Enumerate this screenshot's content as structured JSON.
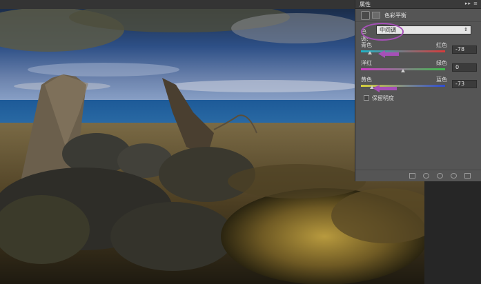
{
  "panel": {
    "tab": "属性",
    "header_title": "色彩平衡",
    "tone": {
      "label": "色调:",
      "value": "中间调"
    },
    "sliders": [
      {
        "left": "青色",
        "right": "红色",
        "value": "-78",
        "level": -78
      },
      {
        "left": "洋红",
        "right": "绿色",
        "value": "0",
        "level": 0
      },
      {
        "left": "黄色",
        "right": "蓝色",
        "value": "-73",
        "level": -73
      }
    ],
    "preserve_luminosity": "保留明度"
  },
  "colors": {
    "annotation": "#a650b8"
  }
}
